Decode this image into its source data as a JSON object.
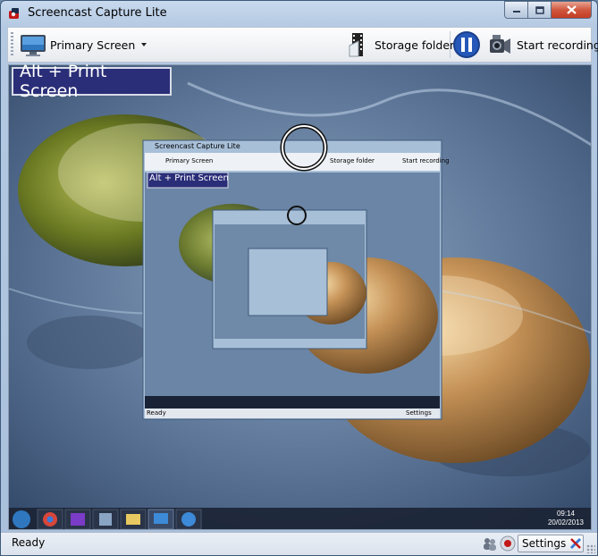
{
  "window": {
    "title": "Screencast Capture Lite"
  },
  "toolbar": {
    "screen_select_label": "Primary Screen",
    "storage_folder_label": "Storage folder",
    "start_recording_label": "Start recording",
    "pause_icon": "pause-icon",
    "accent_color": "#1f4fa8"
  },
  "overlay": {
    "hotkey_text": "Alt + Print Screen"
  },
  "nested_preview": {
    "title": "Screencast Capture Lite",
    "screen_select_label": "Primary Screen",
    "storage_folder_label": "Storage folder",
    "start_recording_label": "Start recording",
    "hotkey_text": "Alt + Print Screen",
    "status_text": "Ready",
    "settings_label": "Settings"
  },
  "taskbar": {
    "time": "09:14",
    "date": "20/02/2013"
  },
  "statusbar": {
    "status_text": "Ready",
    "settings_label": "Settings"
  }
}
